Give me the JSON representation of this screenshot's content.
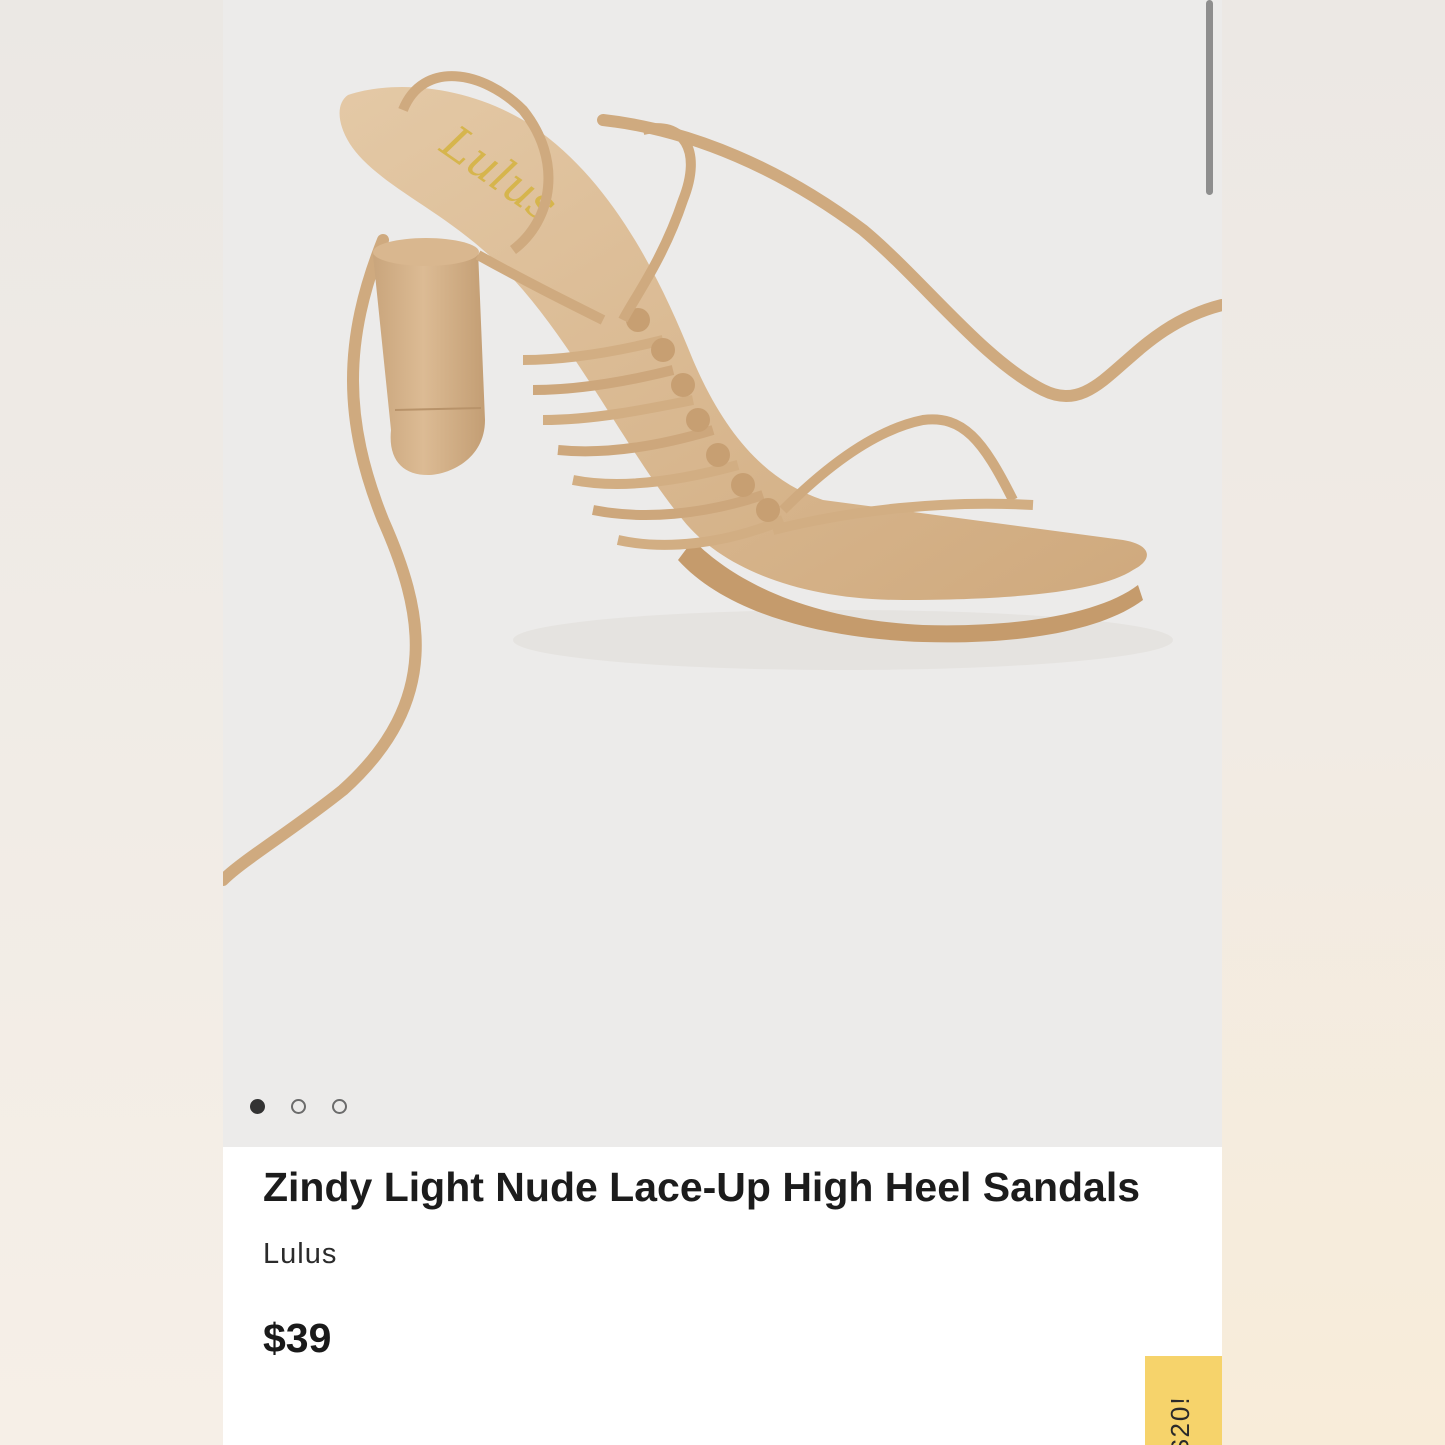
{
  "product": {
    "title": "Zindy Light Nude Lace-Up High Heel Sandals",
    "brand": "Lulus",
    "price": "$39",
    "image_logo_text": "Lulus"
  },
  "gallery": {
    "image_count": 3,
    "active_index": 0
  },
  "promo": {
    "visible_text": "$20!"
  },
  "colors": {
    "background": "#ecebea",
    "sandal": "#d6b48c",
    "promo_tab": "#f6d36b",
    "text": "#1c1c1c"
  }
}
